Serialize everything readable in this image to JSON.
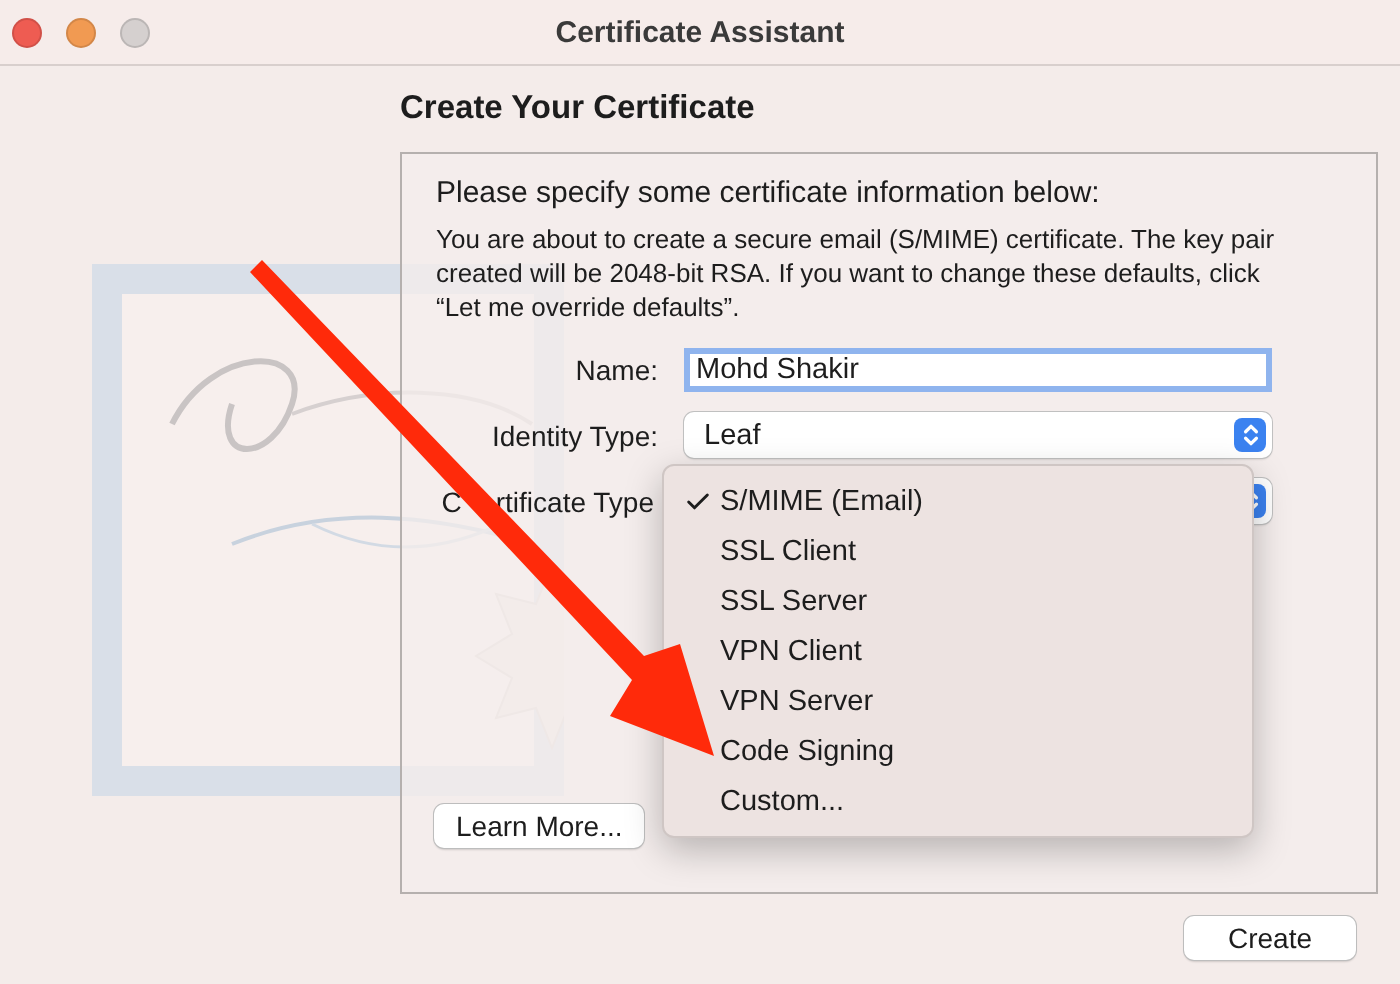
{
  "window": {
    "title": "Certificate Assistant"
  },
  "heading": "Create Your Certificate",
  "panel": {
    "intro": "Please specify some certificate information below:",
    "description": "You are about to create a secure email (S/MIME) certificate. The key pair created will be 2048-bit RSA. If you want to change these defaults, click “Let me override defaults”.",
    "fields": [
      {
        "kind": "text",
        "label": "Name:",
        "value": "Mohd Shakir",
        "focused": true
      },
      {
        "kind": "popup",
        "label": "Identity Type:",
        "value": "Leaf"
      },
      {
        "kind": "popup",
        "label_parts": [
          "C",
          "rtificate Type"
        ]
      }
    ],
    "menu": [
      {
        "label": "S/MIME (Email)",
        "selected": true
      },
      {
        "label": "SSL Client",
        "selected": false
      },
      {
        "label": "SSL Server",
        "selected": false
      },
      {
        "label": "VPN Client",
        "selected": false
      },
      {
        "label": "VPN Server",
        "selected": false
      },
      {
        "label": "Code Signing",
        "selected": false
      },
      {
        "label": "Custom...",
        "selected": false
      }
    ],
    "learn_more": "Learn More..."
  },
  "buttons": [
    "Create"
  ]
}
